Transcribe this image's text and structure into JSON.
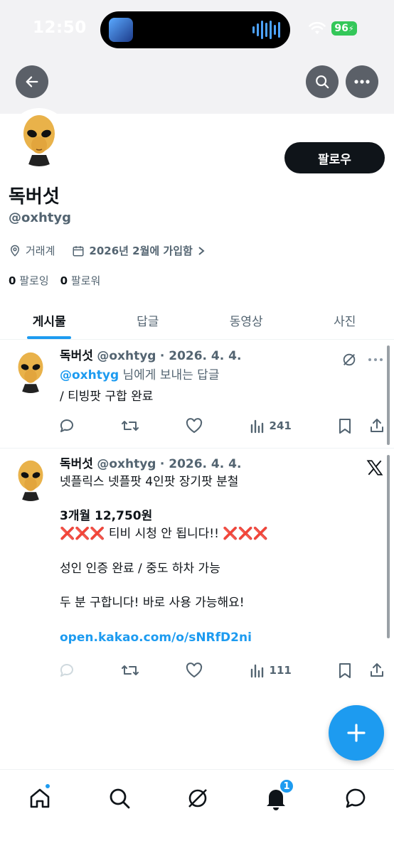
{
  "status_bar": {
    "time": "12:50",
    "battery": "96"
  },
  "profile": {
    "display_name": "독버섯",
    "handle": "@oxhtyg",
    "location": "거래계",
    "joined": "2026년 2월에 가입함",
    "following_count": "0",
    "following_label": "팔로잉",
    "followers_count": "0",
    "followers_label": "팔로워",
    "follow_button": "팔로우"
  },
  "tabs": [
    {
      "label": "게시물",
      "active": true
    },
    {
      "label": "답글",
      "active": false
    },
    {
      "label": "동영상",
      "active": false
    },
    {
      "label": "사진",
      "active": false
    }
  ],
  "posts": [
    {
      "name": "독버섯",
      "handle": "@oxhtyg",
      "date": "· 2026. 4. 4.",
      "reply_to_handle": "@oxhtyg",
      "reply_to_suffix": " 님에게 보내는 답글",
      "text": "/ 티빙팟 구합 완료",
      "views": "241"
    },
    {
      "name": "독버섯",
      "handle": "@oxhtyg",
      "date": "· 2026. 4. 4.",
      "line1": "넷플릭스 넷플팟 4인팟 장기팟 분철",
      "line2": "3개월 12,750원",
      "line3_marks": "❌❌❌",
      "line3_text": " 티비 시청 안 됩니다!! ",
      "line4": "성인 인증 완료 / 중도 하차 가능",
      "line5": "두 분 구합니다! 바로 사용 가능해요!",
      "link": "open.kakao.com/o/sNRfD2ni",
      "views": "111"
    }
  ],
  "notifications_badge": "1",
  "colors": {
    "accent": "#1d9bf0",
    "text": "#0f1419",
    "muted": "#536471"
  }
}
